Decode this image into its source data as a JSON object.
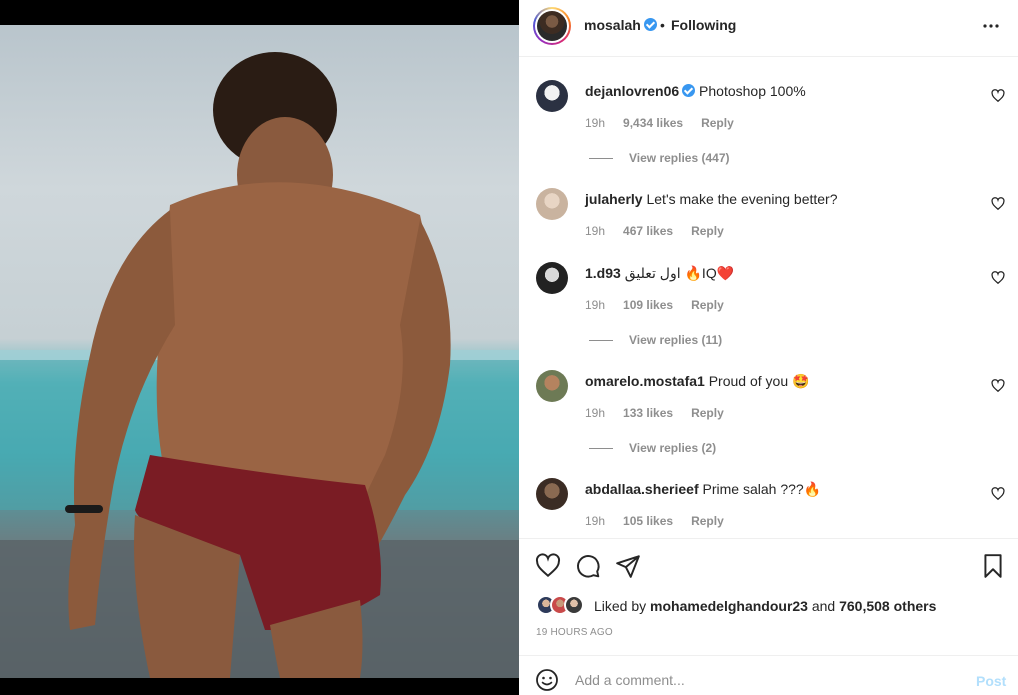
{
  "post": {
    "username": "mosalah",
    "separator": "•",
    "follow_status": "Following",
    "more_icon": "more-horizontal-icon"
  },
  "comments": [
    {
      "username": "dejanlovren06",
      "verified": true,
      "text": "Photoshop 100%",
      "time": "19h",
      "likes": "9,434 likes",
      "reply": "Reply",
      "view_replies": "View replies (447)"
    },
    {
      "username": "julaherly",
      "verified": false,
      "text": "Let's make the evening better?",
      "time": "19h",
      "likes": "467 likes",
      "reply": "Reply"
    },
    {
      "username": "1.d93",
      "verified": false,
      "text": "اول تعليق 🔥IQ❤️",
      "time": "19h",
      "likes": "109 likes",
      "reply": "Reply",
      "view_replies": "View replies (11)"
    },
    {
      "username": "omarelo.mostafa1",
      "verified": false,
      "text": "Proud of you 🤩",
      "time": "19h",
      "likes": "133 likes",
      "reply": "Reply",
      "view_replies": "View replies (2)"
    },
    {
      "username": "abdallaa.sherieef",
      "verified": false,
      "text": "Prime salah ???🔥",
      "time": "19h",
      "likes": "105 likes",
      "reply": "Reply"
    }
  ],
  "actions": {
    "liked_prefix": "Liked by",
    "liked_user": "mohamedelghandour23",
    "liked_and": "and",
    "liked_others": "760,508 others",
    "timestamp": "19 HOURS AGO"
  },
  "add_comment": {
    "placeholder": "Add a comment...",
    "post_label": "Post"
  },
  "colors": {
    "text": "#262626",
    "secondary": "#8e8e8e",
    "verified": "#3897f0",
    "post_disabled": "#b2dffc"
  }
}
